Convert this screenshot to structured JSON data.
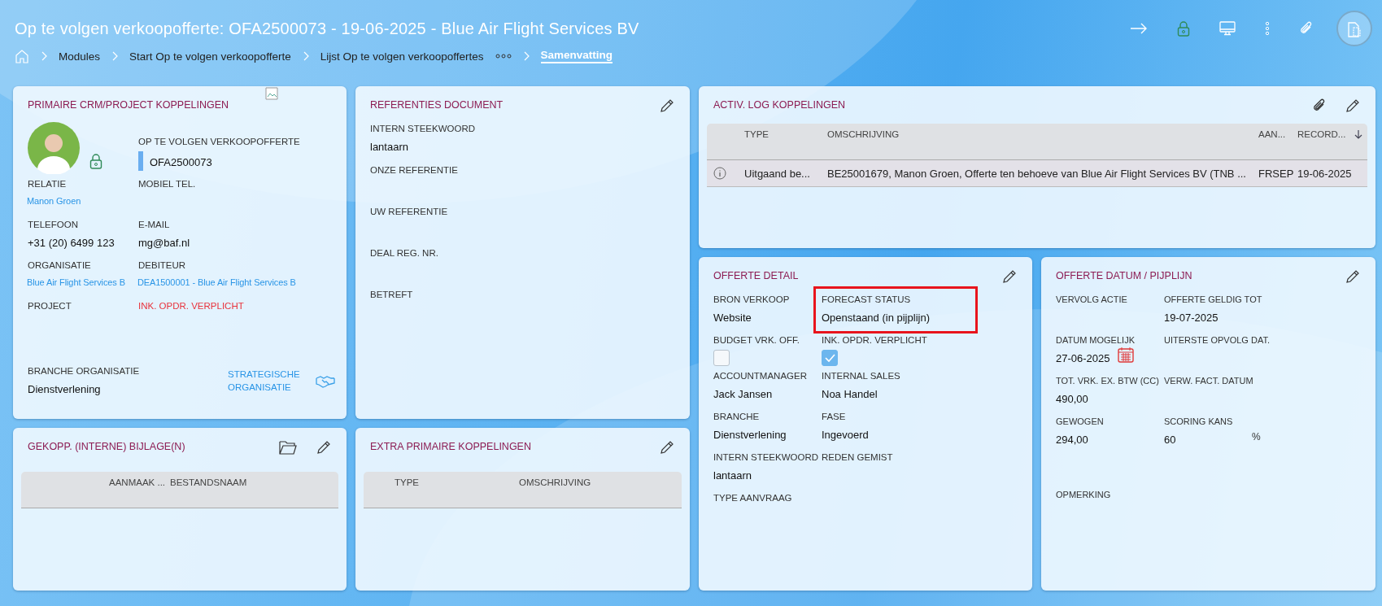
{
  "header": {
    "title": "Op te volgen verkoopofferte: OFA2500073 - 19-06-2025 - Blue Air Flight Services BV",
    "breadcrumbs": [
      {
        "label": "Modules",
        "selected": false
      },
      {
        "label": "Start Op te volgen verkoopofferte",
        "selected": false
      },
      {
        "label": "Lijst Op te volgen verkoopoffertes",
        "selected": false,
        "more": true
      },
      {
        "label": "Samenvatting",
        "selected": true
      }
    ]
  },
  "primary_links": {
    "title": "PRIMAIRE CRM/PROJECT KOPPELINGEN",
    "cells": [
      {
        "kind": "avatar"
      },
      {
        "kind": "badge",
        "label": "OP TE VOLGEN VERKOOPOFFERTE",
        "value": "OFA2500073",
        "color": "#6aaef0"
      },
      {
        "kind": "link",
        "label": "RELATIE",
        "value": "Manon Groen"
      },
      {
        "kind": "text",
        "label": "MOBIEL TEL."
      },
      {
        "kind": "text",
        "label": "TELEFOON",
        "value": "+31 (20) 6499 123"
      },
      {
        "kind": "text",
        "label": "E-MAIL",
        "value": "mg@baf.nl"
      },
      {
        "kind": "link",
        "label": "ORGANISATIE",
        "value": "Blue Air Flight Services B"
      },
      {
        "kind": "link",
        "label": "DEBITEUR",
        "value": "DEA1500001 - Blue Air Flight Services B"
      },
      {
        "kind": "text",
        "label": "PROJECT"
      },
      {
        "kind": "warning",
        "value": "INK. OPDR. VERPLICHT"
      },
      {
        "kind": "text",
        "label": "BRANCHE ORGANISATIE",
        "value": "Dienstverlening"
      },
      {
        "kind": "strategic",
        "value": "STRATEGISCHE ORGANISATIE"
      }
    ]
  },
  "references": {
    "title": "REFERENTIES DOCUMENT",
    "cells": [
      {
        "label": "INTERN STEEKWOORD",
        "value": "lantaarn"
      },
      {
        "label": "ONZE REFERENTIE"
      },
      {
        "label": "UW REFERENTIE"
      },
      {
        "label": "DEAL REG. NR."
      },
      {
        "label": "BETREFT"
      }
    ]
  },
  "activity_log": {
    "title": "ACTIV. LOG KOPPELINGEN",
    "columns": [
      "TYPE",
      "OMSCHRIJVING",
      "AAN...",
      "RECORD..."
    ],
    "rows": [
      {
        "selected": true,
        "cells": [
          "Uitgaand be...",
          "BE25001679, Manon Groen, Offerte ten behoeve van Blue Air Flight Services BV (TNB ...",
          "FRSEP",
          "19-06-2025"
        ]
      }
    ]
  },
  "quote_detail": {
    "title": "OFFERTE DETAIL",
    "cells": [
      {
        "kind": "text",
        "label": "BRON VERKOOP",
        "value": "Website"
      },
      {
        "kind": "text",
        "label": "FORECAST STATUS",
        "value": "Openstaand (in pijplijn)",
        "highlighted": true
      },
      {
        "kind": "checkbox",
        "label": "BUDGET VRK. OFF.",
        "checked": false
      },
      {
        "kind": "checkbox",
        "label": "INK. OPDR. VERPLICHT",
        "checked": true
      },
      {
        "kind": "text",
        "label": "ACCOUNTMANAGER",
        "value": "Jack Jansen"
      },
      {
        "kind": "text",
        "label": "INTERNAL SALES",
        "value": "Noa Handel"
      },
      {
        "kind": "text",
        "label": "BRANCHE",
        "value": "Dienstverlening"
      },
      {
        "kind": "text",
        "label": "FASE",
        "value": "Ingevoerd"
      },
      {
        "kind": "text",
        "label": "INTERN STEEKWOORD",
        "value": "lantaarn"
      },
      {
        "kind": "text",
        "label": "REDEN GEMIST"
      },
      {
        "kind": "text",
        "label": "TYPE AANVRAAG"
      }
    ]
  },
  "quote_dates": {
    "title": "OFFERTE DATUM / PIJPLIJN",
    "cells": [
      {
        "kind": "text",
        "label": "VERVOLG ACTIE"
      },
      {
        "kind": "text",
        "label": "OFFERTE GELDIG TOT",
        "value": "19-07-2025"
      },
      {
        "kind": "date",
        "label": "DATUM MOGELIJK",
        "value": "27-06-2025"
      },
      {
        "kind": "text",
        "label": "UITERSTE OPVOLG DAT."
      },
      {
        "kind": "text",
        "label": "TOT. VRK. EX. BTW (CC)",
        "value": "490,00"
      },
      {
        "kind": "text",
        "label": "VERW. FACT. DATUM"
      },
      {
        "kind": "text",
        "label": "GEWOGEN",
        "value": "294,00"
      },
      {
        "kind": "percent",
        "label": "SCORING KANS",
        "value": "60",
        "unit": "%"
      },
      {
        "kind": "note",
        "label": "OPMERKING"
      }
    ]
  },
  "attachments": {
    "title": "GEKOPP. (INTERNE) BIJLAGE(N)",
    "columns": [
      "AANMAAK ...",
      "BESTANDSNAAM"
    ]
  },
  "extra_links": {
    "title": "EXTRA PRIMAIRE KOPPELINGEN",
    "columns": [
      "TYPE",
      "OMSCHRIJVING"
    ]
  }
}
